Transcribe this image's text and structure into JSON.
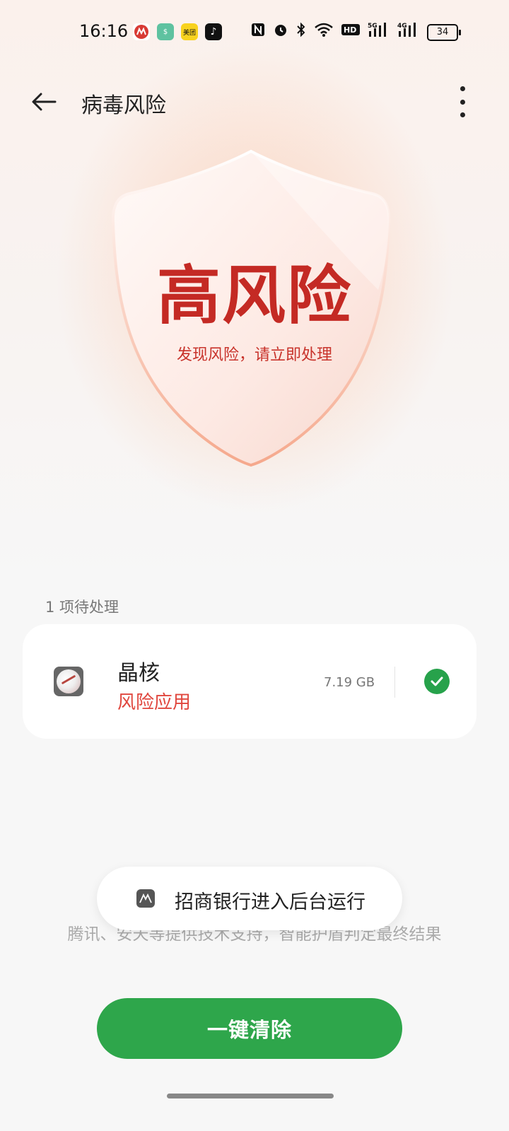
{
  "status_bar": {
    "time": "16:16",
    "apps": [
      {
        "icon": "china-merchants-bank-icon",
        "color": "#d83a34",
        "label": ""
      },
      {
        "icon": "green-app-icon",
        "color": "#5ec2a0",
        "label": "$"
      },
      {
        "icon": "meituan-icon",
        "color": "#f8d21e",
        "label": "美团"
      },
      {
        "icon": "tiktok-icon",
        "color": "#111111",
        "label": "♪"
      }
    ],
    "indicators": [
      "NFC",
      "⏰",
      "✱",
      "WiFi",
      "HD2",
      "5G",
      "4G"
    ],
    "battery": "34"
  },
  "header": {
    "title": "病毒风险"
  },
  "shield": {
    "title": "高风险",
    "subtitle": "发现风险，请立即处理"
  },
  "pending": {
    "label": "1 项待处理",
    "items": [
      {
        "name": "晶核",
        "risk": "风险应用",
        "size": "7.19 GB",
        "checked": true
      }
    ]
  },
  "footnote": "腾讯、安天等提供技术支持，智能护盾判定最终结果",
  "toast": {
    "text": "招商银行进入后台运行"
  },
  "primary_button": {
    "label": "一键清除"
  },
  "colors": {
    "risk_red": "#c42a24",
    "accent_green": "#2ea64b"
  }
}
